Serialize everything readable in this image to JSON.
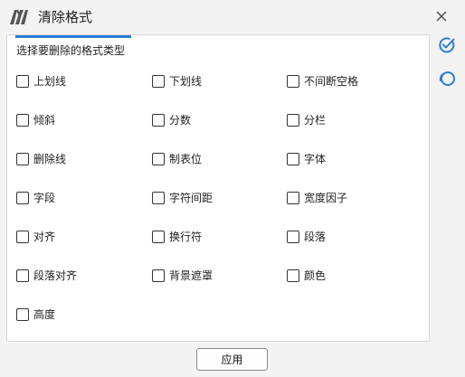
{
  "window": {
    "title": "清除格式"
  },
  "panel": {
    "heading": "选择要删除的格式类型"
  },
  "options": {
    "underline": "上划线",
    "underscore": "下划线",
    "nonbreaking_space": "不间断空格",
    "italic": "倾斜",
    "fraction": "分数",
    "columns": "分栏",
    "strikethrough": "删除线",
    "tab_stop": "制表位",
    "font": "字体",
    "field": "字段",
    "char_spacing": "字符间距",
    "width_factor": "宽度因子",
    "align": "对齐",
    "line_break": "换行符",
    "paragraph": "段落",
    "paragraph_align": "段落对齐",
    "background_mask": "背景遮罩",
    "color": "颜色",
    "height": "高度"
  },
  "footer": {
    "apply_label": "应用"
  },
  "icons": {
    "logo": "app-logo-icon",
    "close": "close-icon",
    "select_all": "select-all-icon",
    "deselect": "deselect-icon"
  },
  "colors": {
    "accent": "#2b7bd8"
  }
}
